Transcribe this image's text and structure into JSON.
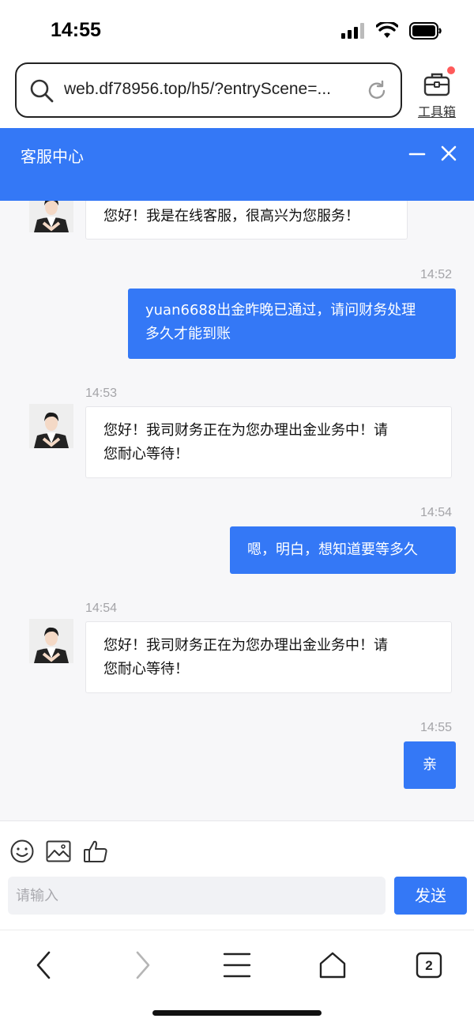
{
  "status_bar": {
    "time": "14:55"
  },
  "browser": {
    "url": "web.df78956.top/h5/?entryScene=...",
    "toolbox_label": "工具箱",
    "tab_count": "2"
  },
  "header": {
    "title": "客服中心"
  },
  "messages": [
    {
      "side": "in",
      "text": "您好！我是在线客服，很高兴为您服务！"
    },
    {
      "side": "out",
      "time": "14:52",
      "text": "yuan6688出金昨晚已通过，请问财务处理久才能到账",
      "line1": "yuan6688出金昨晚已通过，请问财务处理",
      "line2": "多久才能到账"
    },
    {
      "side": "in",
      "time": "14:53",
      "line1": "您好！我司财务正在为您办理出金业务中！请",
      "line2": "您耐心等待！"
    },
    {
      "side": "out",
      "time": "14:54",
      "text": "嗯，明白，想知道要等多久"
    },
    {
      "side": "in",
      "time": "14:54",
      "line1": "您好！我司财务正在为您办理出金业务中！请",
      "line2": "您耐心等待！"
    },
    {
      "side": "out",
      "time": "14:55",
      "text": "亲"
    }
  ],
  "input": {
    "placeholder": "请输入",
    "send_label": "发送"
  },
  "colors": {
    "accent": "#3478f6",
    "chat_bg": "#f7f7f9",
    "notification_dot": "#ff5a5a"
  },
  "icons": {
    "toolbar": [
      "smiley-icon",
      "image-icon",
      "thumbs-up-icon"
    ],
    "nav": [
      "back-icon",
      "forward-icon",
      "menu-icon",
      "home-icon",
      "tabs-icon"
    ]
  }
}
